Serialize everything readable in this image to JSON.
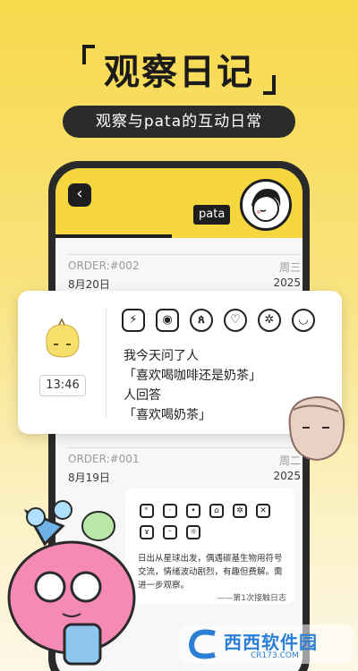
{
  "headline": "观察日记",
  "subheadline": "观察与pata的互动日常",
  "app": {
    "pata_tag": "pata",
    "back_icon": "back-arrow-icon"
  },
  "entries": [
    {
      "order": "ORDER:#002",
      "weekday": "周三",
      "date": "8月20日",
      "year": "2025"
    },
    {
      "order": "ORDER:#001",
      "weekday": "周二",
      "date": "8月19日",
      "year": "2025"
    }
  ],
  "float_card": {
    "time": "13:46",
    "icons": [
      "run-icon",
      "camera-icon",
      "ribbon-icon",
      "heart-icon",
      "gear-face-icon",
      "smile-icon"
    ],
    "lines": [
      "我今天问了人",
      "「喜欢喝咖啡还是奶茶」",
      "人回答",
      "「喜欢喝奶茶」"
    ]
  },
  "lower_card": {
    "text": "日出从星球出发，偶遇碳基生物用符号交流，情绪波动剧烈，有趣但费解。需进一步观察。",
    "signature": "——第1次接触日志"
  },
  "watermark": {
    "text": "西西软件园",
    "sub": "CR173.COM"
  },
  "colors": {
    "brand_yellow": "#f5d63f",
    "dark": "#1e1e1e",
    "watermark_blue": "#2b7fd4"
  }
}
